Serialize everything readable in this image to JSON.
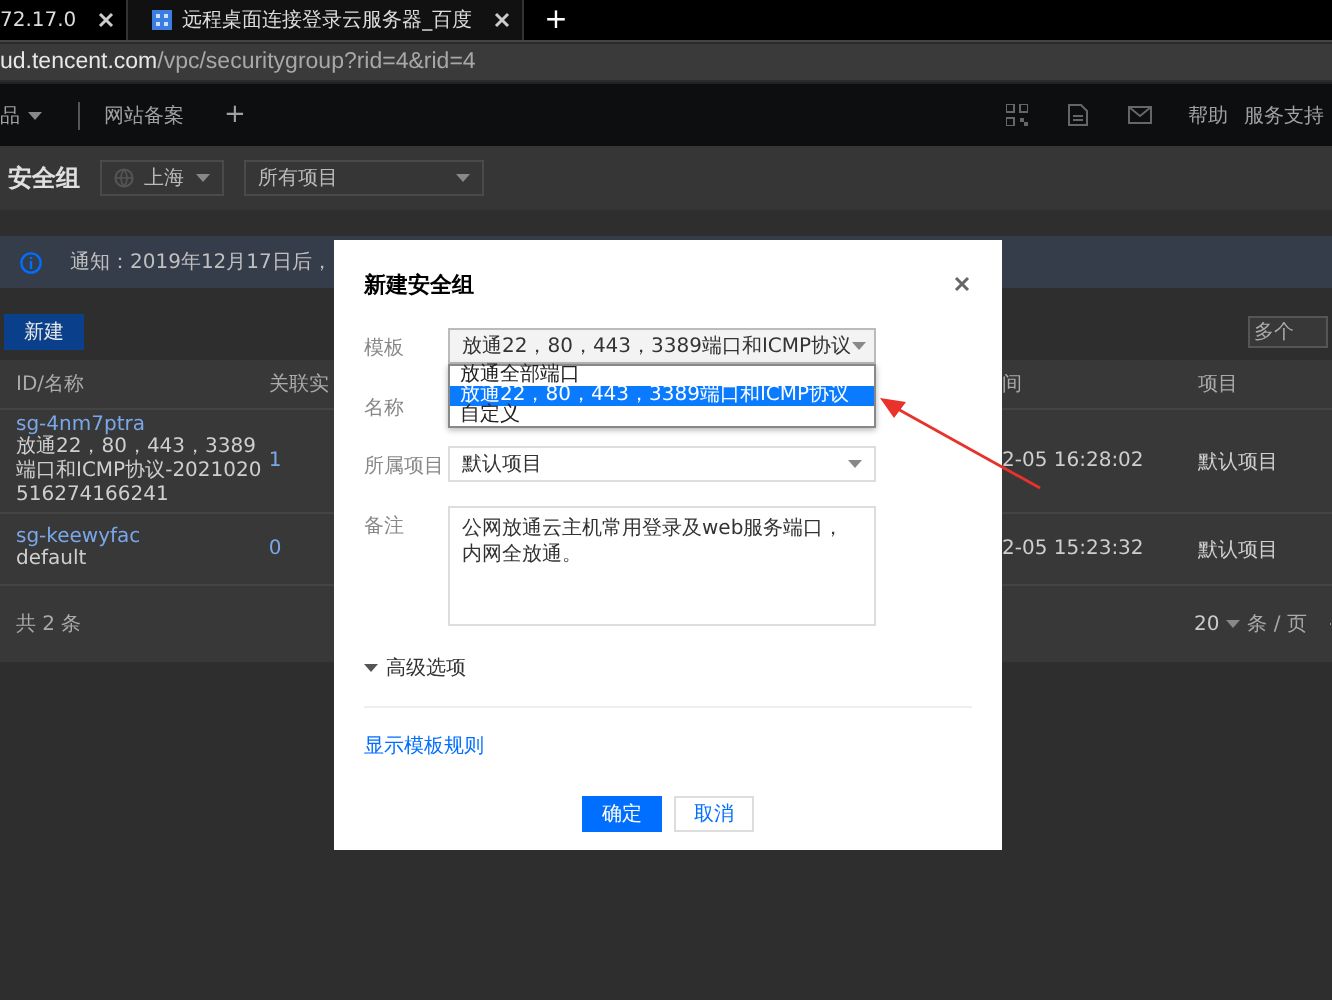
{
  "browser": {
    "tabs": [
      {
        "label": "72.17.0",
        "selected": false
      },
      {
        "label": "远程桌面连接登录云服务器_百度",
        "selected": true
      }
    ],
    "new_tab": "+",
    "url_host": "ud.tencent.com",
    "url_path": "/vpc/securitygroup?rid=4&rid=4"
  },
  "top_nav": {
    "items": [
      "品",
      "网站备案"
    ],
    "add": "+",
    "links": [
      "帮助",
      "服务支持"
    ]
  },
  "page": {
    "title": "安全组",
    "region": "上海",
    "project_filter": "所有项目",
    "notice": "通知：2019年12月17日后，",
    "new_button": "新建",
    "search_placeholder": "多个",
    "table": {
      "columns_left": [
        "ID/名称",
        "关联实"
      ],
      "columns_right": [
        "间",
        "项目"
      ],
      "rows": [
        {
          "id": "sg-4nm7ptra",
          "name": "放通22，80，443，3389端口和ICMP协议-2021020516274166241",
          "count": "1",
          "time": "2-05 16:28:02",
          "project": "默认项目"
        },
        {
          "id": "sg-keewyfac",
          "name": "default",
          "count": "0",
          "time": "2-05 15:23:32",
          "project": "默认项目"
        }
      ]
    },
    "footer": {
      "total": "共 2 条",
      "page_size": "20",
      "per_page": "条 / 页"
    }
  },
  "dialog": {
    "title": "新建安全组",
    "fields": [
      {
        "kind": "select",
        "label": "模板",
        "value": "放通22，80，443，3389端口和ICMP协议",
        "expanded": true,
        "options": [
          {
            "label": "放通全部端口",
            "selected": false
          },
          {
            "label": "放通22，80，443，3389端口和ICMP协议",
            "selected": true
          },
          {
            "label": "自定义",
            "selected": false
          }
        ]
      },
      {
        "kind": "covered",
        "label": "名称"
      },
      {
        "kind": "select",
        "label": "所属项目",
        "value": "默认项目",
        "expanded": false
      },
      {
        "kind": "textarea",
        "label": "备注",
        "value": "公网放通云主机常用登录及web服务端口，内网全放通。"
      }
    ],
    "advanced": "高级选项",
    "rule_link": "显示模板规则",
    "buttons": [
      {
        "kind": "primary",
        "label": "确定"
      },
      {
        "kind": "secondary",
        "label": "取消"
      }
    ]
  }
}
